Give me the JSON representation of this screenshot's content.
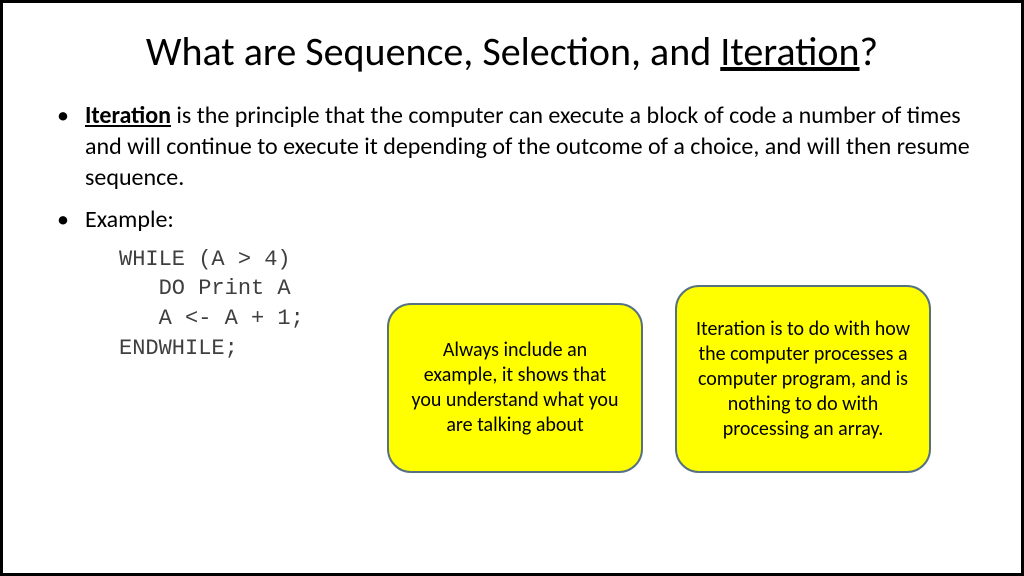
{
  "title": {
    "prefix": "What are Sequence, Selection, and ",
    "underlined": "Iteration",
    "suffix": "?"
  },
  "bullets": {
    "iteration": {
      "term": "Iteration",
      "rest": " is the principle that the computer can execute a block of code a number of times and will continue to execute it depending of the outcome of a choice, and will then resume sequence."
    },
    "example_label": "Example:"
  },
  "code": "WHILE (A > 4)\n   DO Print A\n   A <- A + 1;\nENDWHILE;",
  "callouts": {
    "left": "Always include an example, it shows that you understand what you are talking about",
    "right": "Iteration is to do with how the computer processes a computer program, and is nothing to do with processing an array."
  }
}
